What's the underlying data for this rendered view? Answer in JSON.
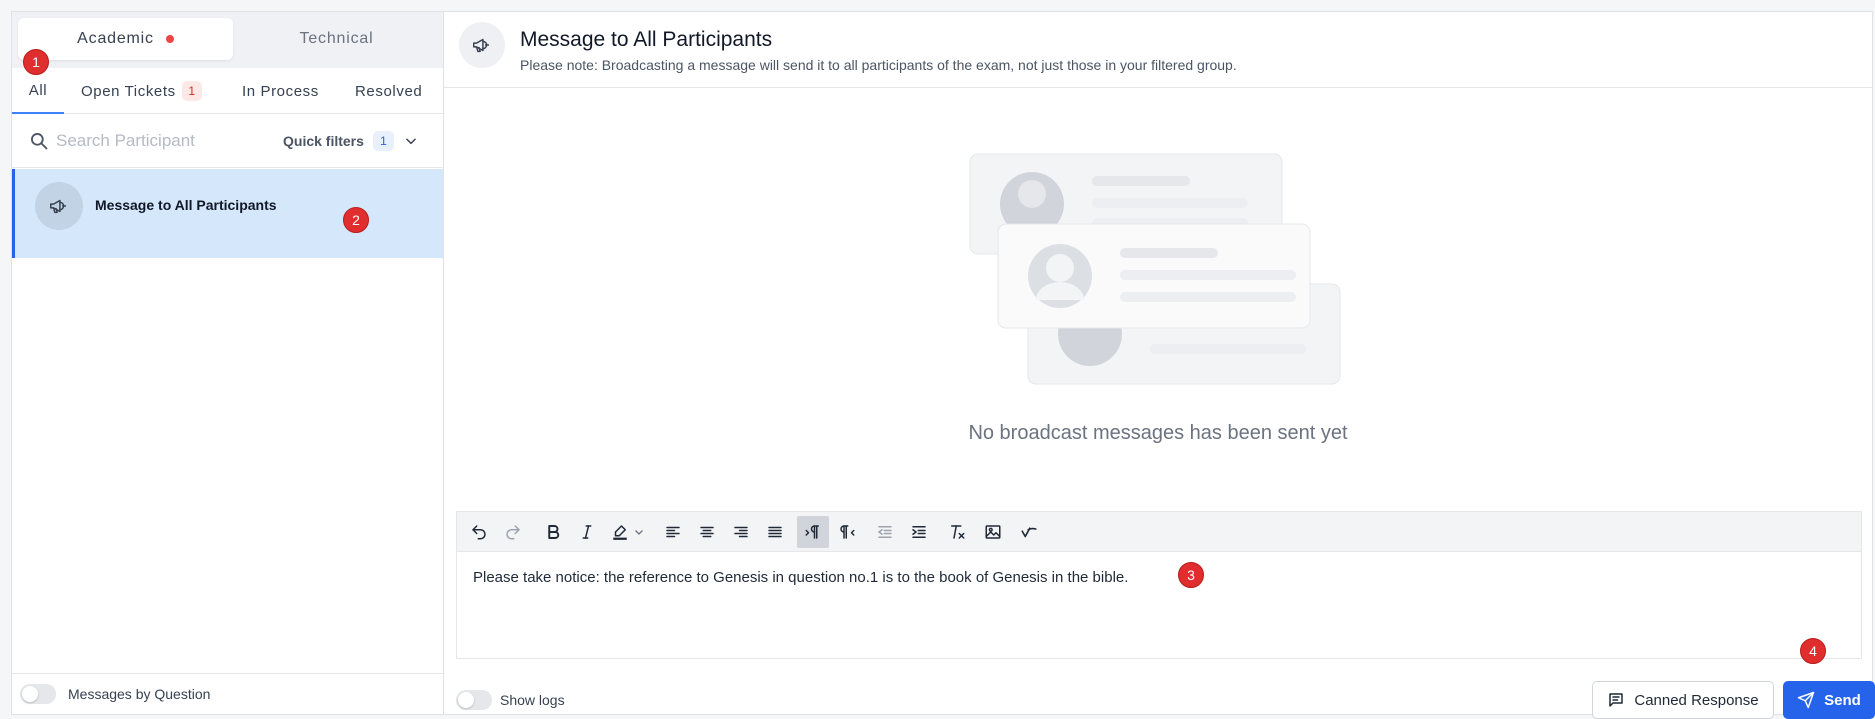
{
  "left": {
    "segments": [
      {
        "label": "Academic",
        "has_alert": true,
        "active": true
      },
      {
        "label": "Technical",
        "active": false
      }
    ],
    "tabs": [
      {
        "label": "All",
        "active": true
      },
      {
        "label": "Open Tickets",
        "count": "1"
      },
      {
        "label": "In Process"
      },
      {
        "label": "Resolved"
      }
    ],
    "search": {
      "placeholder": "Search Participant",
      "value": ""
    },
    "quick_filters": {
      "label": "Quick filters",
      "count": "1"
    },
    "list": [
      {
        "title": "Message to All Participants",
        "icon": "megaphone-icon",
        "selected": true
      }
    ],
    "footer_toggle": {
      "label": "Messages by Question",
      "on": false
    }
  },
  "header": {
    "title": "Message to All Participants",
    "subtitle": "Please note: Broadcasting a message will send it to all participants of the exam, not just those in your filtered group.",
    "icon": "megaphone-icon"
  },
  "empty_state": {
    "text": "No broadcast messages has been sent yet"
  },
  "editor": {
    "toolbar": [
      "undo",
      "redo",
      "bold",
      "italic",
      "highlight",
      "align-left",
      "align-center",
      "align-right",
      "align-justify",
      "ltr",
      "rtl",
      "outdent",
      "indent",
      "clear-format",
      "image",
      "spellcheck"
    ],
    "content": "Please take notice: the reference to Genesis in question no.1 is to the book of Genesis in the bible."
  },
  "footer": {
    "show_logs": {
      "label": "Show logs",
      "on": false
    },
    "canned_label": "Canned Response",
    "send_label": "Send"
  },
  "badges": [
    "1",
    "2",
    "3",
    "4"
  ],
  "colors": {
    "accent": "#2563eb",
    "selected_bg": "#d5e7fb",
    "alert": "#ef4444",
    "badge": "#e02d2d"
  }
}
